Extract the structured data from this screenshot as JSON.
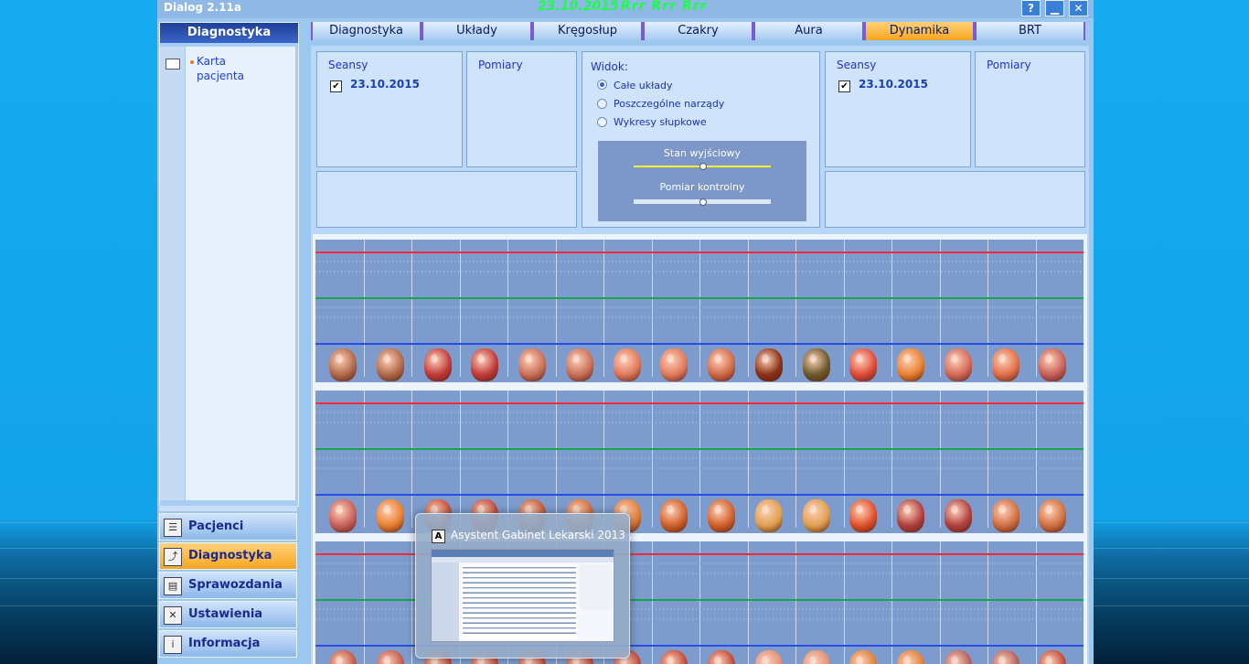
{
  "window": {
    "title": "Dialog 2.11a",
    "date": "23.10.2015",
    "patient": "Rrr Rrr Rrr",
    "buttons": [
      {
        "name": "help-button",
        "icon": "question-icon",
        "glyph": "?"
      },
      {
        "name": "minimize-button",
        "icon": "minimize-icon",
        "glyph": "▁"
      },
      {
        "name": "close-button",
        "icon": "close-icon",
        "glyph": "✕"
      }
    ]
  },
  "sidebar": {
    "header": "Diagnostyka",
    "tree": [
      {
        "label": "Karta pacjenta",
        "icon": "book-icon"
      }
    ]
  },
  "nav": {
    "items": [
      {
        "label": "Pacjenci",
        "icon": "patients-icon",
        "glyph": "☰",
        "active": false
      },
      {
        "label": "Diagnostyka",
        "icon": "diagnostics-chart-icon",
        "glyph": "⤴",
        "active": true
      },
      {
        "label": "Sprawozdania",
        "icon": "printer-icon",
        "glyph": "▤",
        "active": false
      },
      {
        "label": "Ustawienia",
        "icon": "tools-icon",
        "glyph": "✕",
        "active": false
      },
      {
        "label": "Informacja",
        "icon": "info-icon",
        "glyph": "i",
        "active": false
      }
    ]
  },
  "tabs": [
    {
      "label": "Diagnostyka",
      "active": false
    },
    {
      "label": "Układy",
      "active": false
    },
    {
      "label": "Kręgosłup",
      "active": false
    },
    {
      "label": "Czakry",
      "active": false
    },
    {
      "label": "Aura",
      "active": false
    },
    {
      "label": "Dynamika",
      "active": true
    },
    {
      "label": "BRT",
      "active": false
    }
  ],
  "left_session": {
    "seansy_label": "Seansy",
    "seans_date": "23.10.2015",
    "checked": true,
    "pomiary_label": "Pomiary"
  },
  "right_session": {
    "seansy_label": "Seansy",
    "seans_date": "23.10.2015",
    "checked": true,
    "pomiary_label": "Pomiary"
  },
  "view_options": {
    "label": "Widok:",
    "options": [
      {
        "label": "Całe układy",
        "selected": true
      },
      {
        "label": "Poszczególne narządy",
        "selected": false
      },
      {
        "label": "Wykresy słupkowe",
        "selected": false
      }
    ],
    "sliders": [
      {
        "label": "Stan wyjściowy",
        "value": 0.5,
        "color": "#f4f230"
      },
      {
        "label": "Pomiar kontrolny",
        "value": 0.5,
        "color": "#dde8f6"
      }
    ]
  },
  "line_colors": {
    "top": "#ff2a3c",
    "middle": "#14a84a",
    "bottom": "#2a4fe8"
  },
  "organ_rows": [
    [
      {
        "icon": "heart-icon",
        "color": "#b06a4a"
      },
      {
        "icon": "heart-icon",
        "color": "#b06a4a"
      },
      {
        "icon": "vessels-icon",
        "color": "#c03a3a"
      },
      {
        "icon": "vessels-icon",
        "color": "#c03a3a"
      },
      {
        "icon": "bronchi-icon",
        "color": "#c8705a"
      },
      {
        "icon": "bronchi-icon",
        "color": "#c8705a"
      },
      {
        "icon": "lungs-icon",
        "color": "#e07a5c"
      },
      {
        "icon": "lungs-icon",
        "color": "#e07a5c"
      },
      {
        "icon": "head-icon",
        "color": "#d06a48"
      },
      {
        "icon": "liver-icon",
        "color": "#8a3018"
      },
      {
        "icon": "gallbladder-icon",
        "color": "#6a5a2a"
      },
      {
        "icon": "stomach-icon",
        "color": "#e04a3a"
      },
      {
        "icon": "pancreas-icon",
        "color": "#e88030"
      },
      {
        "icon": "intestine-icon",
        "color": "#d46a5a"
      },
      {
        "icon": "duodenum-icon",
        "color": "#e0704a"
      },
      {
        "icon": "colon-icon",
        "color": "#c8605a"
      }
    ],
    [
      {
        "icon": "colon-icon",
        "color": "#c8605a"
      },
      {
        "icon": "pancreas-icon",
        "color": "#e88030"
      },
      {
        "icon": "esophagus-icon",
        "color": "#c8503a"
      },
      {
        "icon": "vessels-icon",
        "color": "#c04a3a"
      },
      {
        "icon": "organ-icon",
        "color": "#c05a3a"
      },
      {
        "icon": "organ-icon",
        "color": "#d0703a"
      },
      {
        "icon": "organ-icon",
        "color": "#e0803a"
      },
      {
        "icon": "kidney-icon",
        "color": "#d0602a"
      },
      {
        "icon": "kidney-icon",
        "color": "#d0602a"
      },
      {
        "icon": "brain-icon",
        "color": "#e0a050"
      },
      {
        "icon": "brain-icon",
        "color": "#e0a050"
      },
      {
        "icon": "adrenal-icon",
        "color": "#e0502a"
      },
      {
        "icon": "thyroid-icon",
        "color": "#b04040"
      },
      {
        "icon": "thyroid-icon",
        "color": "#b04040"
      },
      {
        "icon": "bladder-icon",
        "color": "#d07040"
      },
      {
        "icon": "bladder-icon",
        "color": "#d07040"
      }
    ],
    [
      {
        "icon": "vessels-icon",
        "color": "#c05a4a"
      },
      {
        "icon": "vessels-icon",
        "color": "#c05a4a"
      },
      {
        "icon": "organ-icon",
        "color": "#c04a3a"
      },
      {
        "icon": "organ-icon",
        "color": "#c04a3a"
      },
      {
        "icon": "organ-icon",
        "color": "#c04a3a"
      },
      {
        "icon": "organ-icon",
        "color": "#c04a3a"
      },
      {
        "icon": "organ-icon",
        "color": "#c04a3a"
      },
      {
        "icon": "organ-icon",
        "color": "#c04a3a"
      },
      {
        "icon": "organ-icon",
        "color": "#c04a3a"
      },
      {
        "icon": "organ-icon",
        "color": "#e0907a"
      },
      {
        "icon": "organ-icon",
        "color": "#e0907a"
      },
      {
        "icon": "vessels-icon",
        "color": "#e0803a"
      },
      {
        "icon": "vessels-icon",
        "color": "#e0803a"
      },
      {
        "icon": "organ-icon",
        "color": "#b06060"
      },
      {
        "icon": "organ-icon",
        "color": "#b06060"
      },
      {
        "icon": "organ-icon",
        "color": "#c04a3a"
      }
    ]
  ],
  "taskbar_preview": {
    "title": "Asystent Gabinet Lekarski 2013 ..."
  }
}
